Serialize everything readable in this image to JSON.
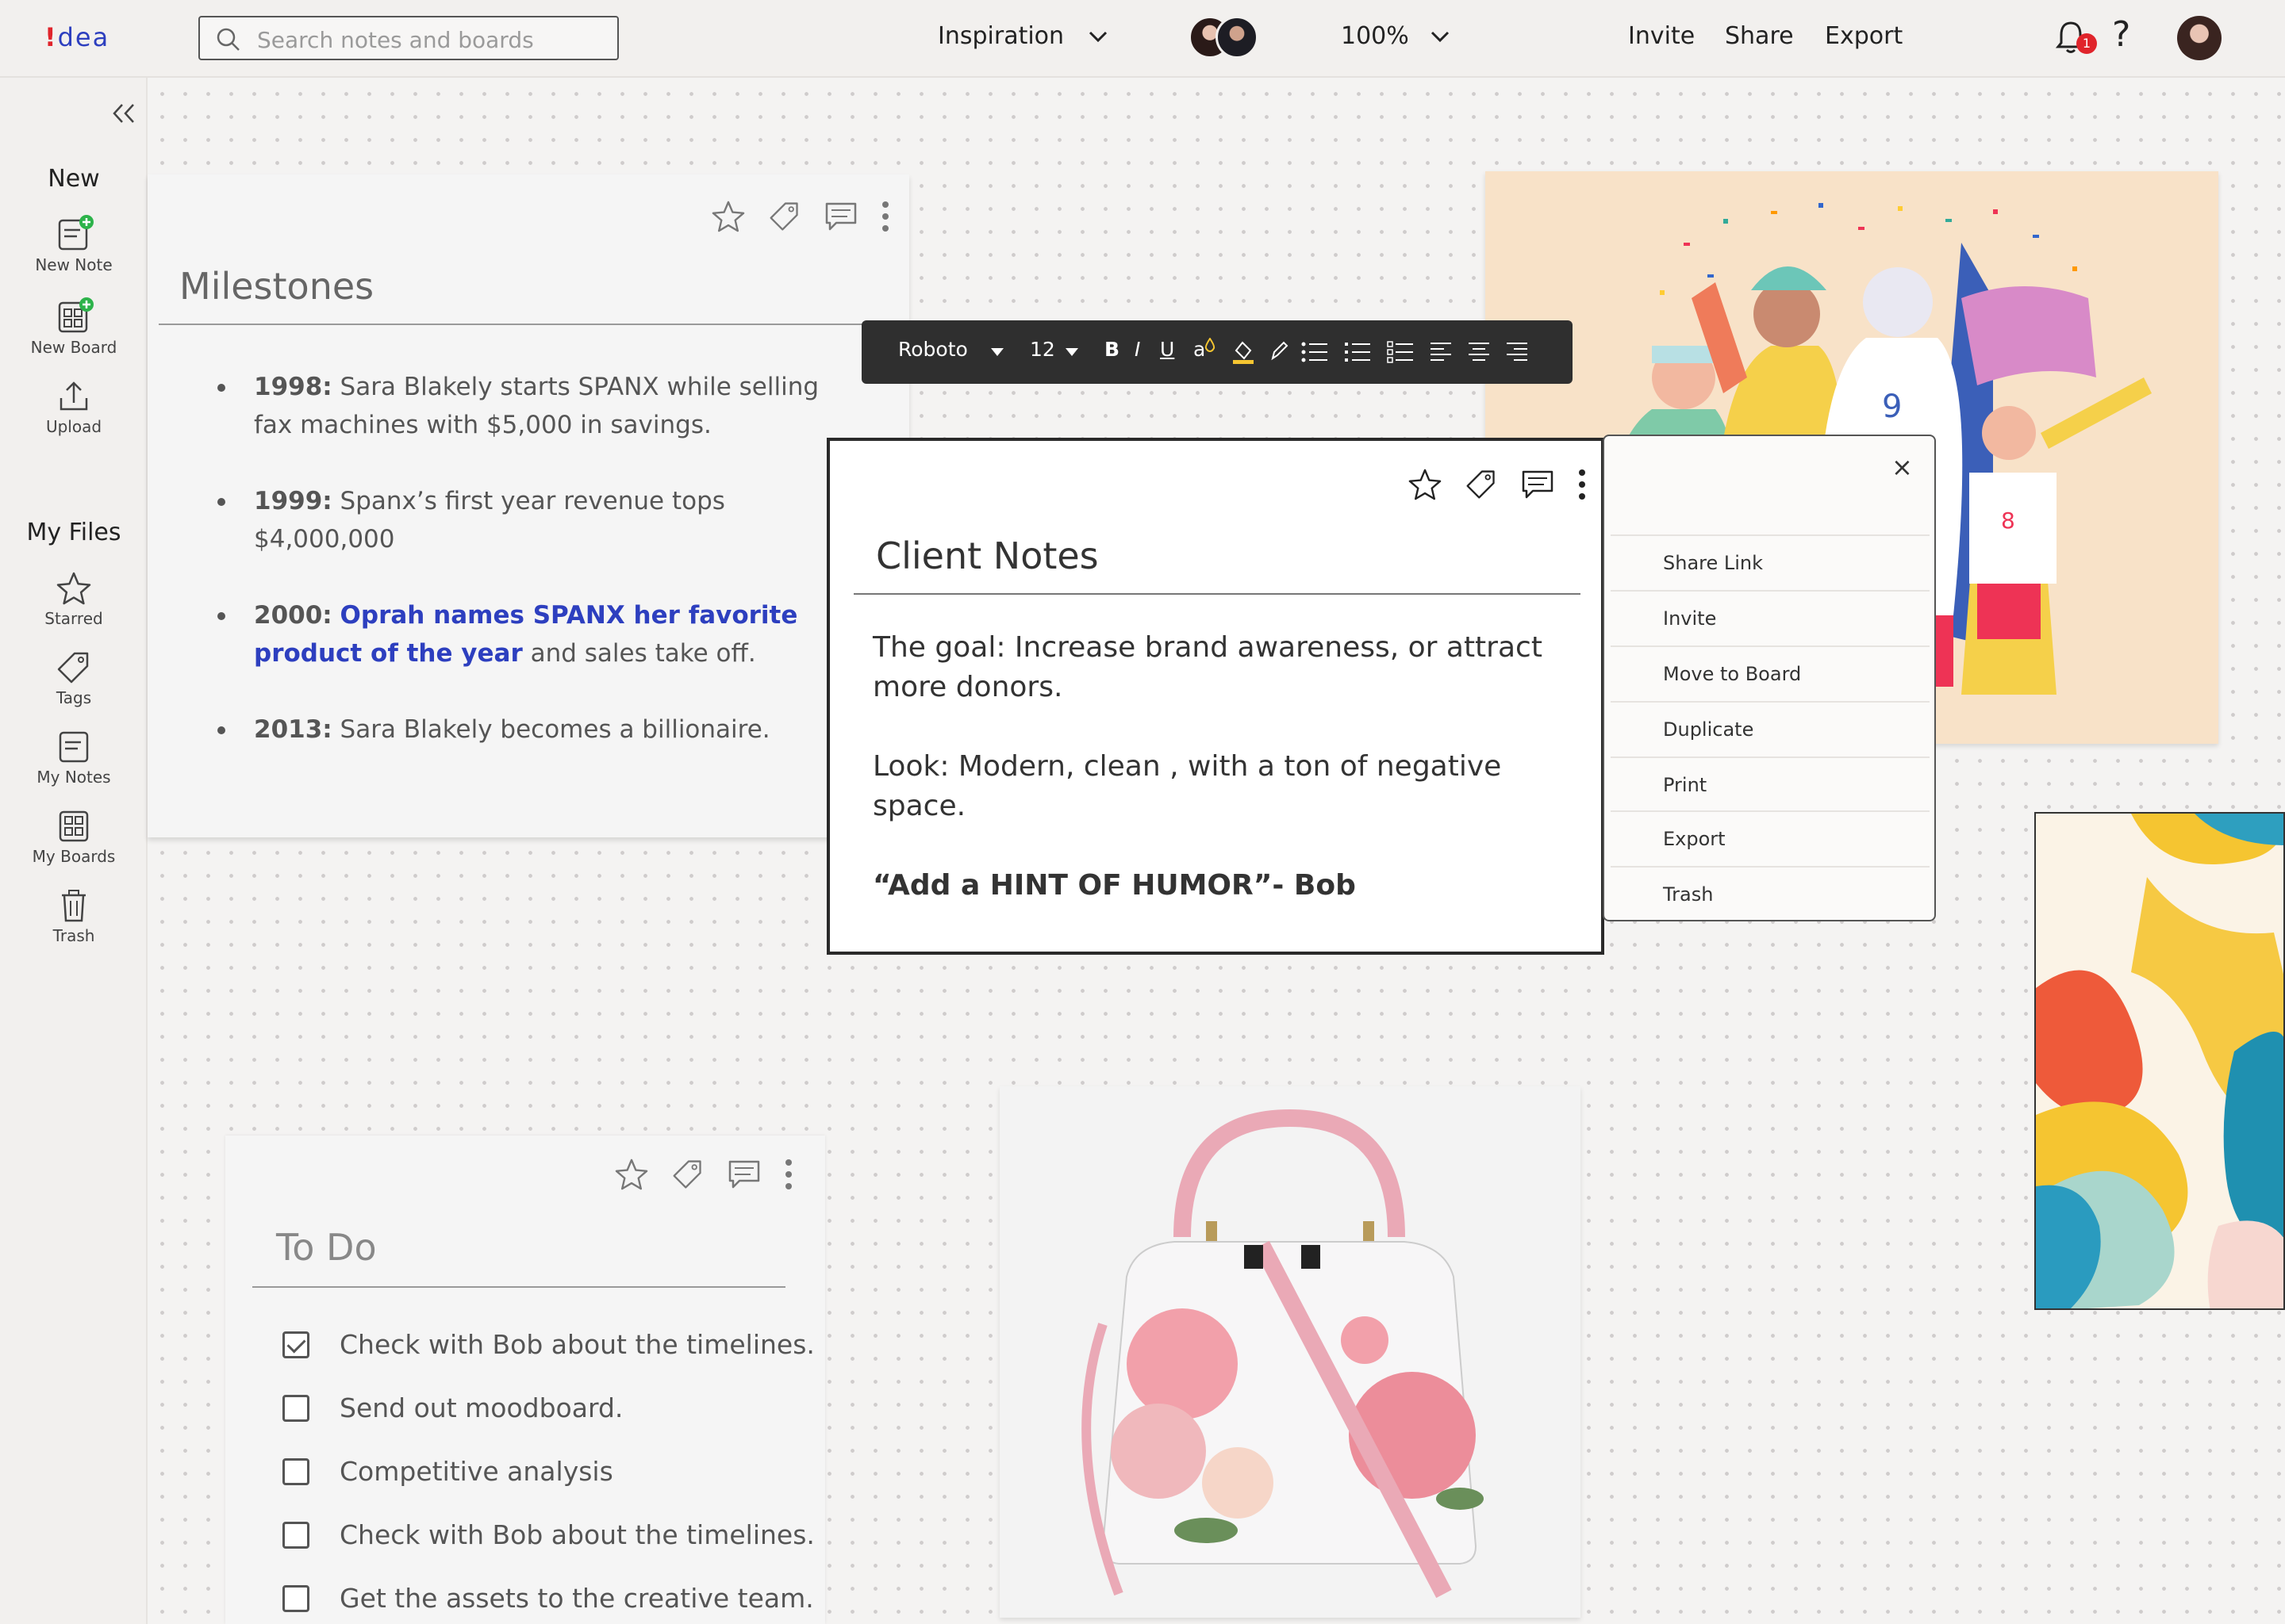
{
  "app": {
    "logo_mark": "!",
    "logo_text": "dea"
  },
  "search": {
    "placeholder": "Search notes and boards"
  },
  "header": {
    "board_name": "Inspiration",
    "zoom": "100%",
    "invite": "Invite",
    "share": "Share",
    "export": "Export",
    "notification_count": "1",
    "help": "?"
  },
  "sidebar": {
    "new_title": "New",
    "new_note": "New Note",
    "new_board": "New Board",
    "upload": "Upload",
    "files_title": "My Files",
    "starred": "Starred",
    "tags": "Tags",
    "my_notes": "My Notes",
    "my_boards": "My Boards",
    "trash": "Trash"
  },
  "milestones": {
    "title": "Milestones",
    "items": [
      {
        "year": "1998:",
        "text": " Sara Blakely starts SPANX while selling fax machines with $5,000 in savings."
      },
      {
        "year": "1999:",
        "text": " Spanx’s first year revenue tops $4,000,000"
      },
      {
        "year": "2000:",
        "link": "Oprah names SPANX her favorite product of the year",
        "text": " and sales take off."
      },
      {
        "year": "2013:",
        "text": " Sara Blakely becomes a billionaire."
      }
    ]
  },
  "toolbar": {
    "font": "Roboto",
    "size": "12",
    "bold": "B",
    "italic": "I",
    "underline": "U",
    "color": "a"
  },
  "client_notes": {
    "title": "Client Notes",
    "goal": "The goal: Increase brand awareness, or attract more donors.",
    "look": "Look:  Modern, clean , with a ton of negative space.",
    "quote": "“Add  a HINT OF HUMOR”- Bob"
  },
  "context_menu": {
    "close": "×",
    "items": [
      "Share Link",
      "Invite",
      "Move to Board",
      "Duplicate",
      "Print",
      "Export",
      "Trash"
    ]
  },
  "todo": {
    "title": "To Do",
    "items": [
      {
        "label": "Check with Bob about the timelines.",
        "checked": true
      },
      {
        "label": "Send out moodboard.",
        "checked": false
      },
      {
        "label": "Competitive analysis",
        "checked": false
      },
      {
        "label": "Check with Bob about the timelines.",
        "checked": false
      },
      {
        "label": "Get the assets to the creative team.",
        "checked": false
      }
    ]
  },
  "colors": {
    "brand": "#2d3fbf",
    "alert": "#e0242b",
    "add": "#2db34a"
  }
}
